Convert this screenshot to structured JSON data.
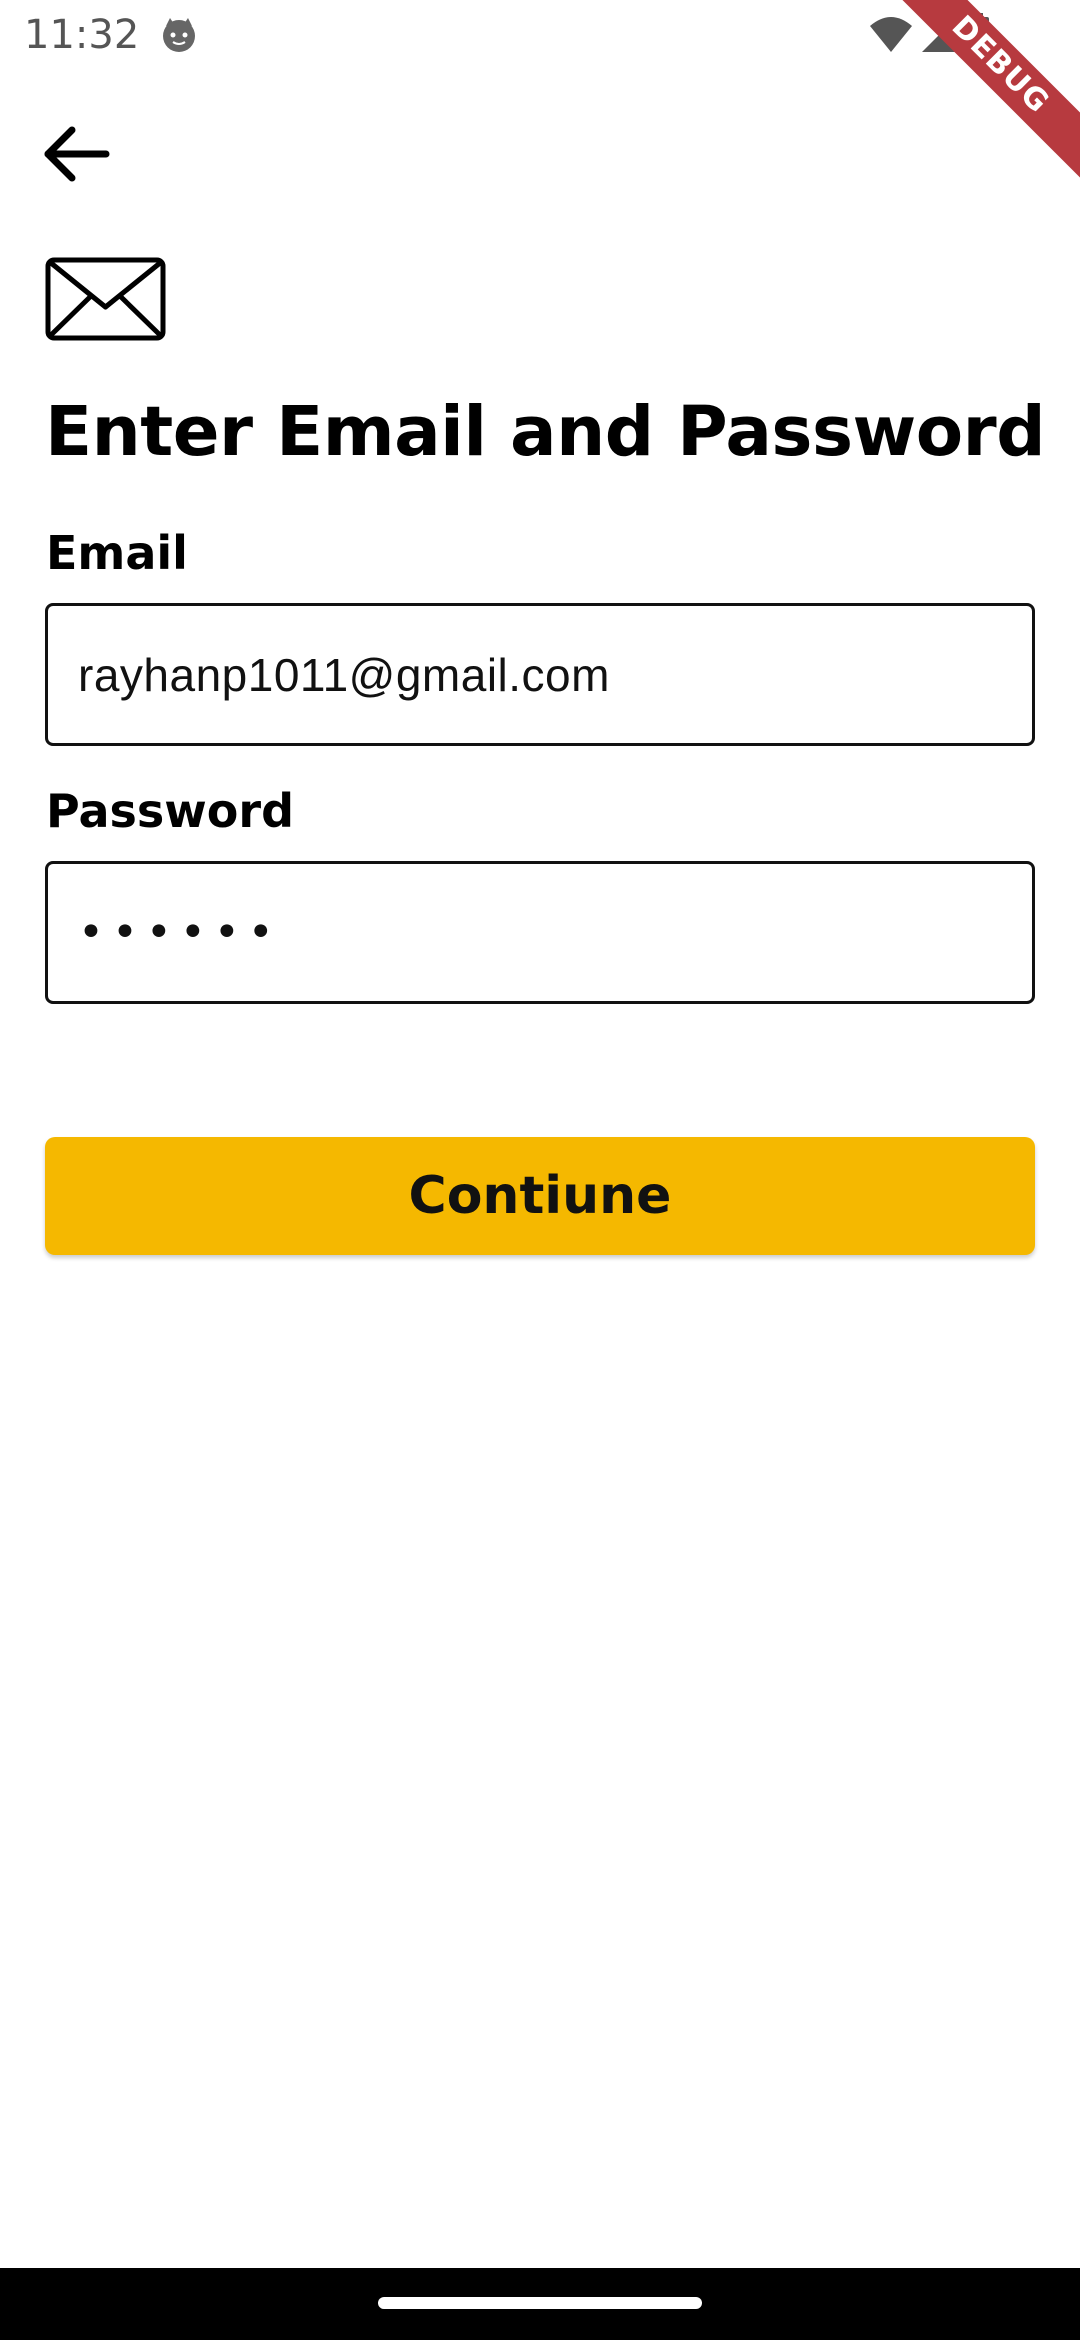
{
  "status_bar": {
    "time": "11:32",
    "app_icon": "cat-face-icon",
    "icons": [
      "wifi-icon",
      "signal-icon",
      "battery-icon"
    ]
  },
  "debug_banner": {
    "label": "DEBUG",
    "color": "#b73a3f"
  },
  "header": {
    "back_icon": "arrow-left-icon",
    "mail_icon": "envelope-icon",
    "title": "Enter Email and Password"
  },
  "form": {
    "email_label": "Email",
    "email_value": "rayhanp1011@gmail.com",
    "password_label": "Password",
    "password_value": "••••••",
    "submit_label": "Contiune"
  },
  "colors": {
    "accent": "#f5b800",
    "text": "#000000",
    "background": "#ffffff"
  }
}
